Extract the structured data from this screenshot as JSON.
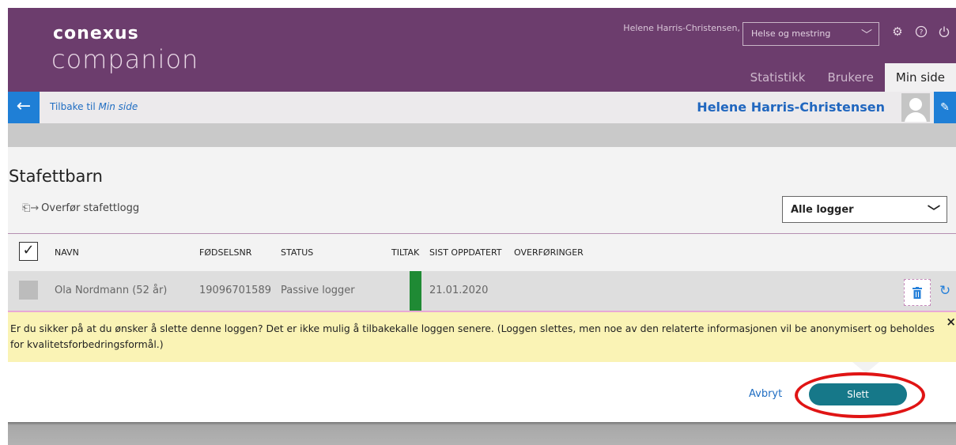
{
  "header": {
    "logo_top": "conexus",
    "logo_bottom": "companion",
    "user_name": "Helene Harris-Christensen,",
    "role_select": "Helse og mestring",
    "tabs": [
      {
        "label": "Statistikk",
        "active": false
      },
      {
        "label": "Brukere",
        "active": false
      },
      {
        "label": "Min side",
        "active": true
      }
    ]
  },
  "backbar": {
    "back_prefix": "Tilbake til ",
    "back_target": "Min side",
    "person_name": "Helene Harris-Christensen"
  },
  "content": {
    "title": "Stafettbarn",
    "transfer_label": "Overfør stafettlogg",
    "log_filter": "Alle logger",
    "columns": [
      "NAVN",
      "FØDSELSNR",
      "STATUS",
      "TILTAK",
      "SIST OPPDATERT",
      "OVERFØRINGER"
    ],
    "rows": [
      {
        "navn": "Ola Nordmann (52 år)",
        "fodselsnr": "19096701589",
        "status": "Passive logger",
        "tiltak_color": "#1f8a34",
        "sist_oppdatert": "21.01.2020",
        "overforinger": ""
      }
    ]
  },
  "warning": {
    "text": "Er du sikker på at du ønsker å slette denne loggen? Det er ikke mulig å tilbakekalle loggen senere. (Loggen slettes, men noe av den relaterte informasjonen vil be anonymisert og beholdes for kvalitetsforbedringsformål.)",
    "close": "×"
  },
  "confirm": {
    "cancel_label": "Avbryt",
    "delete_label": "Slett"
  },
  "icons": {
    "settings": "gear-icon",
    "help": "help-icon",
    "power": "power-icon",
    "back": "arrow-left-icon",
    "edit": "pencil-icon",
    "trash": "trash-icon",
    "refresh": "refresh-icon"
  },
  "colors": {
    "brand": "#6c3d6d",
    "link": "#1f6dc2",
    "accent_blue": "#1f7fd6",
    "delete_button": "#167889",
    "warning_bg": "#faf3b5",
    "highlight": "#e01414"
  }
}
